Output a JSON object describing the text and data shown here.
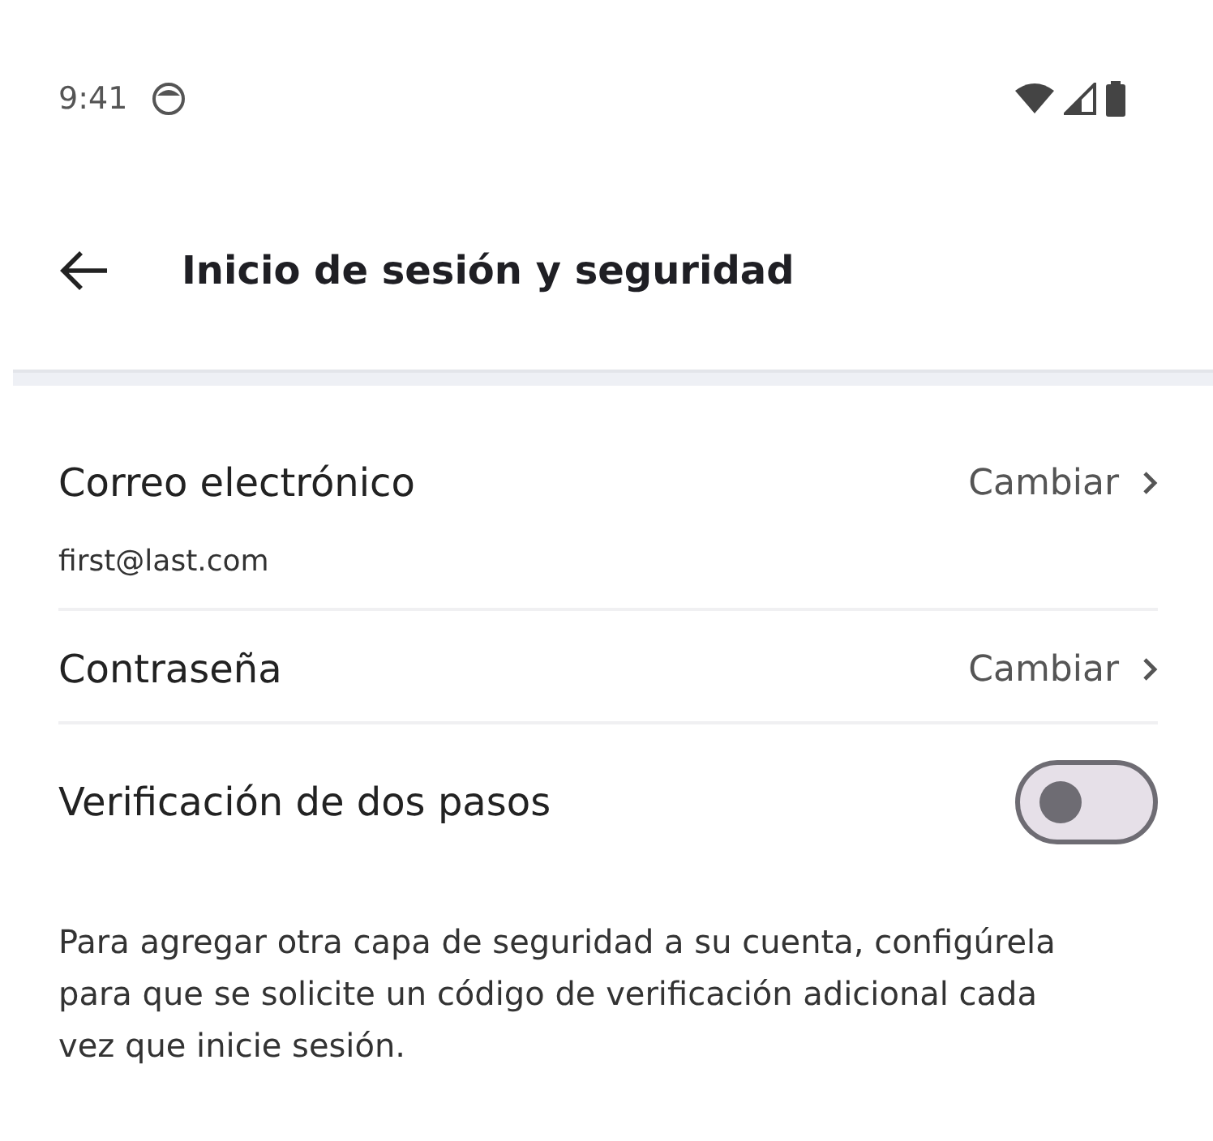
{
  "status_bar": {
    "time": "9:41"
  },
  "header": {
    "title": "Inicio de sesión y seguridad"
  },
  "settings": [
    {
      "kind": "link",
      "label": "Correo electrónico",
      "action": "Cambiar",
      "value": "first@last.com"
    },
    {
      "kind": "link",
      "label": "Contraseña",
      "action": "Cambiar"
    },
    {
      "kind": "toggle",
      "label": "Verificación de dos pasos",
      "on": false,
      "description": "Para agregar otra capa de seguridad a su cuenta, configúrela para que se solicite un código de verificación adicional cada vez que inicie sesión."
    }
  ]
}
